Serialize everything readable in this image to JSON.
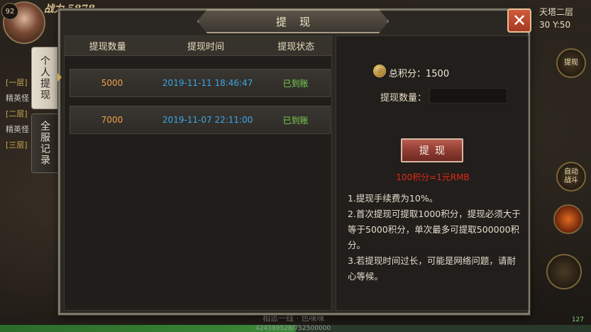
{
  "hud": {
    "level": "92",
    "power": "战力 5878",
    "map_name": "天塔二层",
    "map_coord": "30 Y:50",
    "quests": [
      "[一层]",
      "精英怪",
      "[二层]",
      "精英怪",
      "[三层]"
    ],
    "btn_auto": "自动\n战斗",
    "btn_withdraw_top": "提现",
    "chat": "相思一线 · 色咪咪",
    "exp": "424389528/752500000",
    "signal": "127"
  },
  "dialog": {
    "title": "提现",
    "close_icon": "close-icon",
    "tabs": [
      {
        "label": "个人提现",
        "active": true
      },
      {
        "label": "全服记录",
        "active": false
      }
    ],
    "table": {
      "headers": [
        "提现数量",
        "提现时间",
        "提现状态"
      ],
      "rows": [
        {
          "amount": "5000",
          "time": "2019-11-11 18:46:47",
          "status": "已到账"
        },
        {
          "amount": "7000",
          "time": "2019-11-07 22:11:00",
          "status": "已到账"
        }
      ]
    },
    "panel": {
      "total_label": "总积分：1500",
      "qty_label": "提现数量：",
      "qty_value": "",
      "withdraw_button": "提现",
      "rate": "100积分=1元RMB",
      "rules": [
        "1.提现手续费为10%。",
        "2.首次提现可提取1000积分，提现必须大于等于5000积分，单次最多可提取500000积分。",
        "3.若提现时间过长，可能是网络问题，请耐心等候。"
      ]
    }
  },
  "colors": {
    "amount": "#f0a24a",
    "time": "#3aa8e8",
    "status": "#7cd450",
    "rate": "#e02a1a",
    "close": "#c04a2e"
  }
}
